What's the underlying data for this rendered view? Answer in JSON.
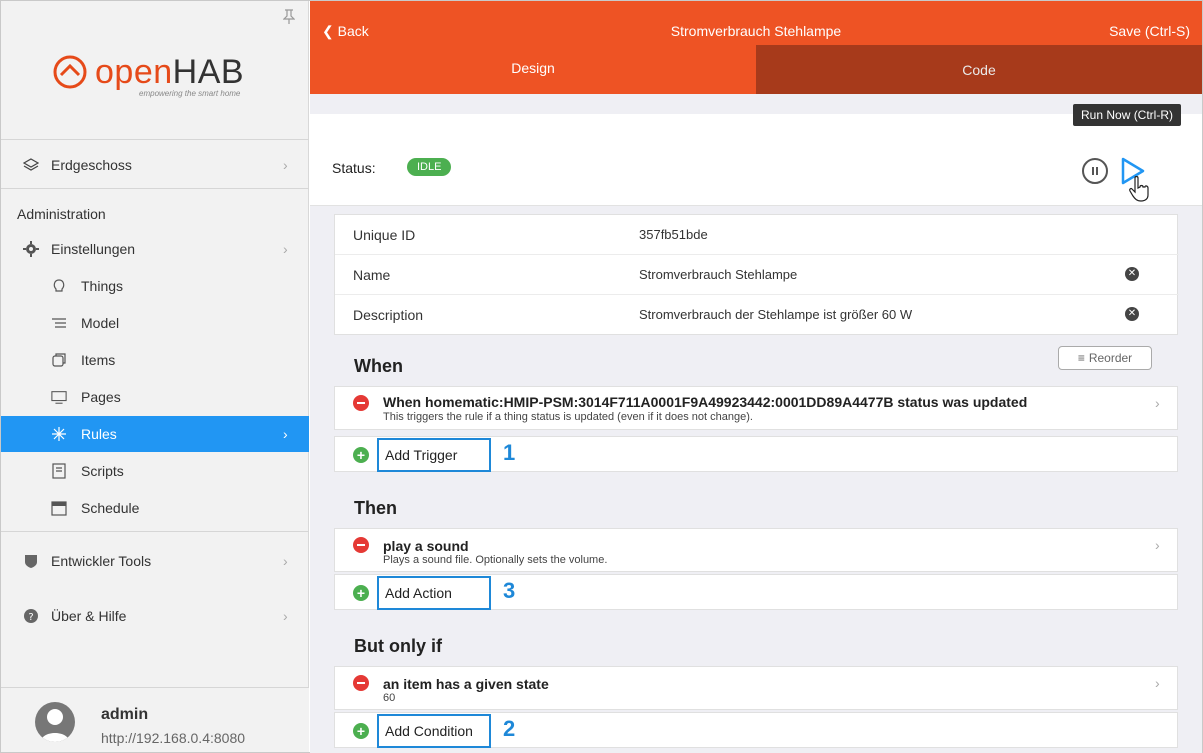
{
  "sidebar": {
    "logo_open": "open",
    "logo_hab": "HAB",
    "logo_tagline": "empowering the smart home",
    "top_item": "Erdgeschoss",
    "section_title": "Administration",
    "items": [
      {
        "label": "Einstellungen",
        "icon": "gear-icon"
      },
      {
        "label": "Things",
        "icon": "lightbulb-icon"
      },
      {
        "label": "Model",
        "icon": "list-icon"
      },
      {
        "label": "Items",
        "icon": "items-icon"
      },
      {
        "label": "Pages",
        "icon": "monitor-icon"
      },
      {
        "label": "Rules",
        "icon": "sparkle-icon"
      },
      {
        "label": "Scripts",
        "icon": "script-icon"
      },
      {
        "label": "Schedule",
        "icon": "calendar-icon"
      },
      {
        "label": "Entwickler Tools",
        "icon": "shield-icon"
      },
      {
        "label": "Über & Hilfe",
        "icon": "help-icon"
      }
    ],
    "user": {
      "name": "admin",
      "url": "http://192.168.0.4:8080"
    }
  },
  "topbar": {
    "back": "Back",
    "title": "Stromverbrauch Stehlampe",
    "save": "Save (Ctrl-S)"
  },
  "tabs": {
    "design": "Design",
    "code": "Code"
  },
  "status": {
    "label": "Status:",
    "value": "IDLE",
    "tooltip": "Run Now (Ctrl-R)"
  },
  "properties": [
    {
      "key": "Unique ID",
      "value": "357fb51bde"
    },
    {
      "key": "Name",
      "value": "Stromverbrauch Stehlampe"
    },
    {
      "key": "Description",
      "value": "Stromverbrauch der Stehlampe ist größer 60 W"
    }
  ],
  "when": {
    "title": "When",
    "reorder": "Reorder",
    "trigger_title": "When homematic:HMIP-PSM:3014F711A0001F9A49923442:0001DD89A4477B status was updated",
    "trigger_sub": "This triggers the rule if a thing status is updated (even if it does not change).",
    "add_label": "Add Trigger",
    "step": "1"
  },
  "then": {
    "title": "Then",
    "action_title": "play a sound",
    "action_sub": "Plays a sound file. Optionally sets the volume.",
    "add_label": "Add Action",
    "step": "3"
  },
  "but_only_if": {
    "title": "But only if",
    "cond_title": "an item has a given state",
    "cond_sub": "60",
    "add_label": "Add Condition",
    "step": "2"
  },
  "colors": {
    "accent": "#ee5324",
    "tab_inactive": "#a73a1b",
    "active_nav": "#2196f3",
    "status_idle": "#4caf50",
    "annotation": "#1e88d8"
  }
}
